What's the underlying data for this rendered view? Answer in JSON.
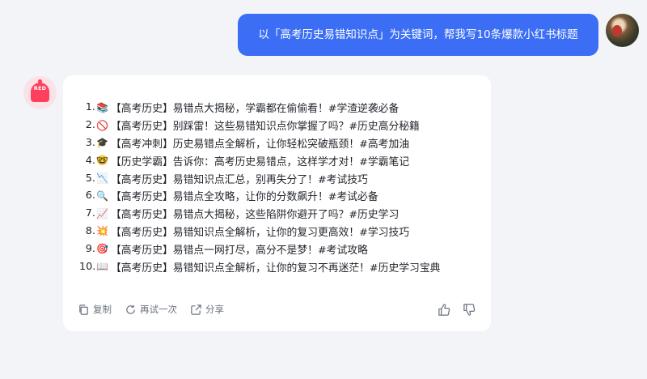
{
  "user_message": {
    "text": "以「高考历史易错知识点」为关键词，帮我写10条爆款小红书标题"
  },
  "bot": {
    "avatar_label": "RED",
    "titles": [
      {
        "num": "1.",
        "emoji": "📚",
        "text": "【高考历史】易错点大揭秘，学霸都在偷偷看！#学渣逆袭必备"
      },
      {
        "num": "2.",
        "emoji": "🚫",
        "text": "【高考历史】别踩雷！这些易错知识点你掌握了吗？#历史高分秘籍"
      },
      {
        "num": "3.",
        "emoji": "🎓",
        "text": "【高考冲刺】历史易错点全解析，让你轻松突破瓶颈！#高考加油"
      },
      {
        "num": "4.",
        "emoji": "🤓",
        "text": "【历史学霸】告诉你：高考历史易错点，这样学才对！#学霸笔记"
      },
      {
        "num": "5.",
        "emoji": "📉",
        "text": "【高考历史】易错知识点汇总，别再失分了！#考试技巧"
      },
      {
        "num": "6.",
        "emoji": "🔍",
        "text": "【高考历史】易错点全攻略，让你的分数飙升！#考试必备"
      },
      {
        "num": "7.",
        "emoji": "📈",
        "text": "【高考历史】易错点大揭秘，这些陷阱你避开了吗？#历史学习"
      },
      {
        "num": "8.",
        "emoji": "💥",
        "text": "【高考历史】易错知识点全解析，让你的复习更高效！#学习技巧"
      },
      {
        "num": "9.",
        "emoji": "🎯",
        "text": "【高考历史】易错点一网打尽，高分不是梦！#考试攻略"
      },
      {
        "num": "10.",
        "emoji": "📖",
        "text": "【高考历史】易错知识点全解析，让你的复习不再迷茫！#历史学习宝典"
      }
    ],
    "actions": {
      "copy_label": "复制",
      "retry_label": "再试一次",
      "share_label": "分享"
    }
  },
  "icons": {
    "copy": "copy-icon",
    "retry": "refresh-icon",
    "share": "share-icon",
    "like": "thumbs-up-icon",
    "dislike": "thumbs-down-icon"
  },
  "colors": {
    "user_bubble": "#3b6ef5",
    "background": "#f3f4f8",
    "brand_red": "#ff3f5e"
  }
}
